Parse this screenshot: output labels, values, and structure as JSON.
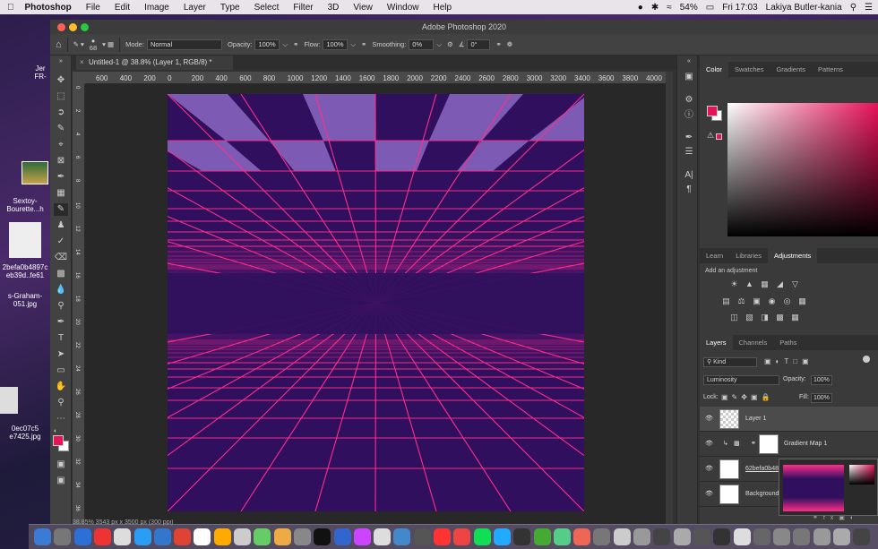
{
  "menubar": {
    "apple": "",
    "app": "Photoshop",
    "items": [
      "File",
      "Edit",
      "Image",
      "Layer",
      "Type",
      "Select",
      "Filter",
      "3D",
      "View",
      "Window",
      "Help"
    ],
    "battery": "54%",
    "time": "Fri 17:03",
    "user": "Lakiya Butler-kania"
  },
  "desktop": {
    "icons": [
      {
        "label": "Jer\nFR-"
      },
      {
        "label": "Sextoy-\nBourette...h"
      },
      {
        "label": "2befa0b4897c\neb39d..fe61"
      },
      {
        "label": "s-Graham-\n051.jpg"
      },
      {
        "label": "0ec07c5\ne7425.jpg"
      }
    ]
  },
  "window": {
    "title": "Adobe Photoshop 2020"
  },
  "options": {
    "brush_size": "68",
    "mode_label": "Mode:",
    "mode": "Normal",
    "opacity_label": "Opacity:",
    "opacity": "100%",
    "flow_label": "Flow:",
    "flow": "100%",
    "smoothing_label": "Smoothing:",
    "smoothing": "0%",
    "angle": "0°"
  },
  "document": {
    "tab": "Untitled-1 @ 38.8% (Layer 1, RGB/8) *",
    "hruler": [
      "600",
      "400",
      "200",
      "0",
      "200",
      "400",
      "600",
      "800",
      "1000",
      "1200",
      "1400",
      "1600",
      "1800",
      "2000",
      "2200",
      "2400",
      "2600",
      "2800",
      "3000",
      "3200",
      "3400",
      "3600",
      "3800",
      "4000"
    ],
    "vruler": [
      "0",
      "2",
      "4",
      "6",
      "8",
      "10",
      "12",
      "14",
      "16",
      "18",
      "20",
      "22",
      "24",
      "26",
      "28",
      "30",
      "32",
      "34",
      "36"
    ],
    "status": "38.85%   3543 px x 3500 px (300 ppi)"
  },
  "panels": {
    "color_tabs": [
      "Color",
      "Swatches",
      "Gradients",
      "Patterns"
    ],
    "adjust_tabs": [
      "Learn",
      "Libraries",
      "Adjustments"
    ],
    "add_adjustment": "Add an adjustment",
    "layer_tabs": [
      "Layers",
      "Channels",
      "Paths"
    ],
    "kind": "Kind",
    "blend": "Luminosity",
    "opacity_label": "Opacity:",
    "opacity": "100%",
    "lock_label": "Lock:",
    "fill_label": "Fill:",
    "fill": "100%",
    "layers": [
      {
        "name": "Layer 1"
      },
      {
        "name": "Gradient Map 1"
      },
      {
        "name": "62befa0b4897c717feb39d2be768fe61"
      },
      {
        "name": "Background"
      }
    ]
  },
  "colors": {
    "fg": "#e8125a",
    "bg": "#ffffff",
    "art_bg": "#30105e",
    "grid": "#ff2d8a",
    "tile": "#7d5bb4"
  }
}
